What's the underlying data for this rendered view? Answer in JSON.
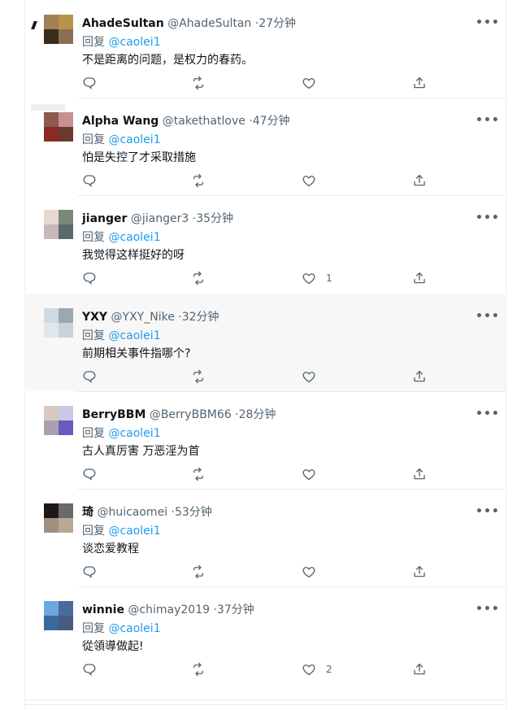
{
  "colors": {
    "accent": "#1d9bf0",
    "text": "#0f1419",
    "muted": "#536471",
    "highlight": "#f7f7f7",
    "divider": "#e6e9ec"
  },
  "icons": {
    "more": "more-horizontal-icon",
    "reply": "reply-icon",
    "retweet": "retweet-icon",
    "like": "heart-icon",
    "share": "share-icon"
  },
  "tweets": [
    {
      "name": "AhadeSultan",
      "handle": "@AhadeSultan",
      "time": "27分钟",
      "reply_prefix": "回复 ",
      "reply_to": "@caolei1",
      "text": "不是距离的问题，是权力的春药。",
      "likes": "",
      "avatar": [
        "#a08055",
        "#b8944a",
        "#3a2d20",
        "#8a7050"
      ]
    },
    {
      "name": "Alpha Wang",
      "handle": "@takethatlove",
      "time": "47分钟",
      "reply_prefix": "回复 ",
      "reply_to": "@caolei1",
      "text": "怕是失控了才采取措施",
      "likes": "",
      "avatar": [
        "#8a5a50",
        "#c89090",
        "#8a2a25",
        "#6a3a30"
      ]
    },
    {
      "name": "jianger",
      "handle": "@jianger3",
      "time": "35分钟",
      "reply_prefix": "回复 ",
      "reply_to": "@caolei1",
      "text": "我觉得这样挺好的呀",
      "likes": "1",
      "avatar": [
        "#e8d8d0",
        "#7a8a7a",
        "#c8b8b8",
        "#5a6a6a"
      ]
    },
    {
      "name": "YXY",
      "handle": "@YXY_Nike",
      "time": "32分钟",
      "reply_prefix": "回复 ",
      "reply_to": "@caolei1",
      "text": "前期相关事件指哪个?",
      "likes": "",
      "avatar": [
        "#d0dae2",
        "#9aa8b2",
        "#e0e6ea",
        "#c8d2da"
      ]
    },
    {
      "name": "BerryBBM",
      "handle": "@BerryBBM66",
      "time": "28分钟",
      "reply_prefix": "回复 ",
      "reply_to": "@caolei1",
      "text": "古人真厉害 万恶淫为首",
      "likes": "",
      "avatar": [
        "#d8c8c0",
        "#c8c8e8",
        "#a8a0b0",
        "#6a5ac0"
      ]
    },
    {
      "name": "琦",
      "handle": "@huicaomei",
      "time": "53分钟",
      "reply_prefix": "回复 ",
      "reply_to": "@caolei1",
      "text": "谈恋爱教程",
      "likes": "",
      "avatar": [
        "#201818",
        "#6a6a6a",
        "#a09080",
        "#b8a898"
      ]
    },
    {
      "name": "winnie",
      "handle": "@chimay2019",
      "time": "37分钟",
      "reply_prefix": "回复 ",
      "reply_to": "@caolei1",
      "text": "從領導做起!",
      "likes": "2",
      "avatar": [
        "#6aa8e0",
        "#4a6a9a",
        "#3a6a9a",
        "#4a5a80"
      ]
    }
  ]
}
